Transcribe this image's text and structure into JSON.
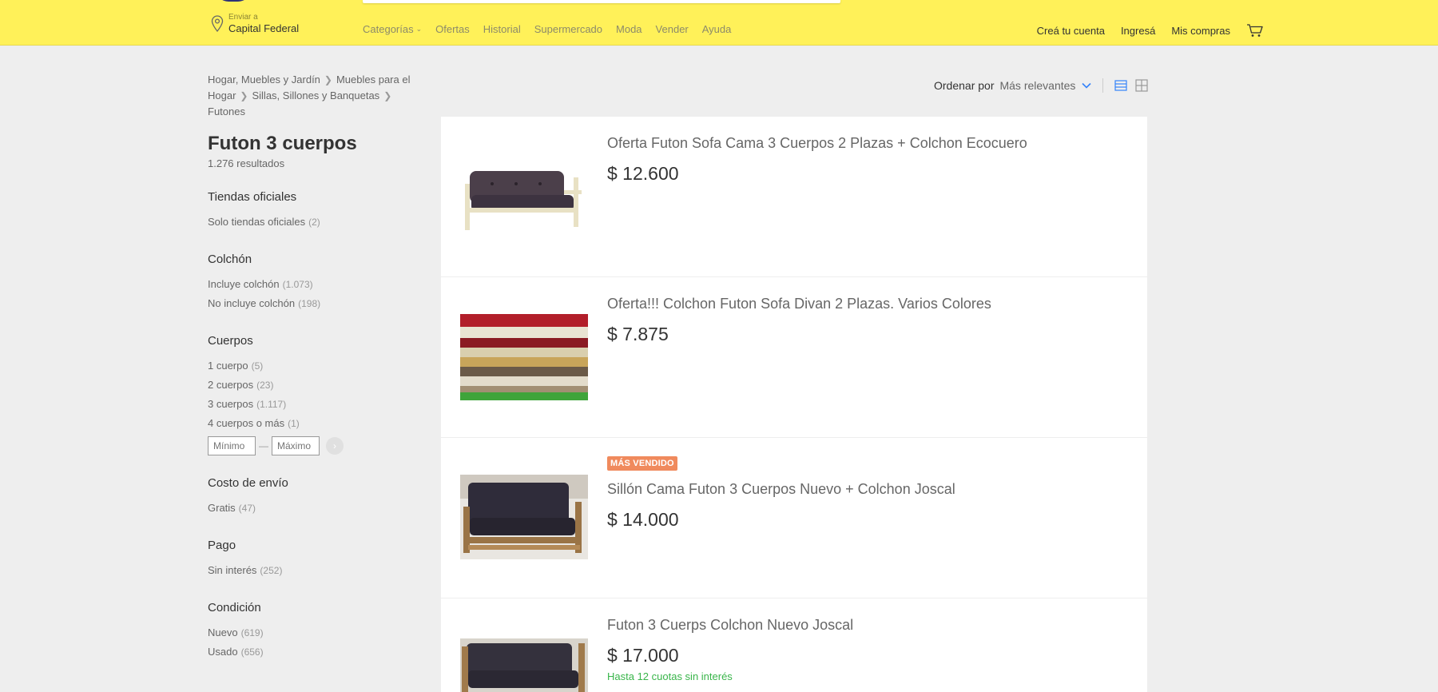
{
  "header": {
    "location": {
      "small": "Enviar a",
      "city": "Capital Federal"
    },
    "nav": [
      {
        "label": "Categorías",
        "caret": "⌄"
      },
      {
        "label": "Ofertas"
      },
      {
        "label": "Historial"
      },
      {
        "label": "Supermercado"
      },
      {
        "label": "Moda"
      },
      {
        "label": "Vender"
      },
      {
        "label": "Ayuda"
      }
    ],
    "user_nav": [
      "Creá tu cuenta",
      "Ingresá",
      "Mis compras"
    ],
    "colors": {
      "bar": "#fff159",
      "brand_dark": "#2d3277"
    }
  },
  "breadcrumb": [
    "Hogar, Muebles y Jardín",
    "Muebles para el Hogar",
    "Sillas, Sillones y Banquetas",
    "Futones"
  ],
  "search": {
    "title": "Futon 3 cuerpos",
    "results": "1.276 resultados"
  },
  "filters": {
    "official": {
      "title": "Tiendas oficiales",
      "options": [
        {
          "label": "Solo tiendas oficiales",
          "count": "(2)"
        }
      ]
    },
    "mattress": {
      "title": "Colchón",
      "options": [
        {
          "label": "Incluye colchón",
          "count": "(1.073)"
        },
        {
          "label": "No incluye colchón",
          "count": "(198)"
        }
      ]
    },
    "bodies": {
      "title": "Cuerpos",
      "options": [
        {
          "label": "1 cuerpo",
          "count": "(5)"
        },
        {
          "label": "2 cuerpos",
          "count": "(23)"
        },
        {
          "label": "3 cuerpos",
          "count": "(1.117)"
        },
        {
          "label": "4 cuerpos o más",
          "count": "(1)"
        }
      ],
      "min_placeholder": "Mínimo",
      "dash": "—",
      "max_placeholder": "Máximo",
      "go": "›"
    },
    "shipping": {
      "title": "Costo de envío",
      "options": [
        {
          "label": "Gratis",
          "count": "(47)"
        }
      ]
    },
    "payment": {
      "title": "Pago",
      "options": [
        {
          "label": "Sin interés",
          "count": "(252)"
        }
      ]
    },
    "condition": {
      "title": "Condición",
      "options": [
        {
          "label": "Nuevo",
          "count": "(619)"
        },
        {
          "label": "Usado",
          "count": "(656)"
        }
      ]
    }
  },
  "toolbar": {
    "sort_label": "Ordenar por",
    "sort_value": "Más relevantes",
    "accent": "#3483fa"
  },
  "results": [
    {
      "title": "Oferta Futon Sofa Cama 3 Cuerpos 2 Plazas + Colchon Ecocuero",
      "price": "$ 12.600",
      "badge": "",
      "installments": "",
      "thumb_icon": "futon-sofa-image"
    },
    {
      "title": "Oferta!!! Colchon Futon Sofa Divan 2 Plazas. Varios Colores",
      "price": "$ 7.875",
      "badge": "",
      "installments": "",
      "thumb_icon": "mattress-stack-image"
    },
    {
      "title": "Sillón Cama Futon 3 Cuerpos Nuevo + Colchon Joscal",
      "price": "$ 14.000",
      "badge": "MÁS VENDIDO",
      "installments": "",
      "thumb_icon": "futon-couch-image"
    },
    {
      "title": "Futon 3 Cuerps Colchon Nuevo Joscal",
      "price": "$ 17.000",
      "badge": "",
      "installments": "Hasta 12 cuotas sin interés",
      "thumb_icon": "futon-couch-image"
    }
  ]
}
